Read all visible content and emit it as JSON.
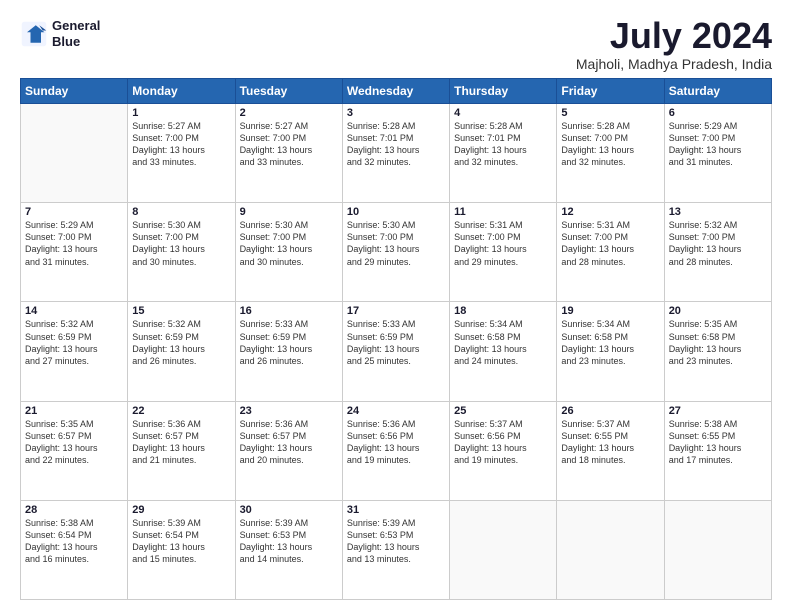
{
  "logo": {
    "line1": "General",
    "line2": "Blue"
  },
  "title": "July 2024",
  "location": "Majholi, Madhya Pradesh, India",
  "headers": [
    "Sunday",
    "Monday",
    "Tuesday",
    "Wednesday",
    "Thursday",
    "Friday",
    "Saturday"
  ],
  "weeks": [
    [
      {
        "day": "",
        "info": ""
      },
      {
        "day": "1",
        "info": "Sunrise: 5:27 AM\nSunset: 7:00 PM\nDaylight: 13 hours\nand 33 minutes."
      },
      {
        "day": "2",
        "info": "Sunrise: 5:27 AM\nSunset: 7:00 PM\nDaylight: 13 hours\nand 33 minutes."
      },
      {
        "day": "3",
        "info": "Sunrise: 5:28 AM\nSunset: 7:01 PM\nDaylight: 13 hours\nand 32 minutes."
      },
      {
        "day": "4",
        "info": "Sunrise: 5:28 AM\nSunset: 7:01 PM\nDaylight: 13 hours\nand 32 minutes."
      },
      {
        "day": "5",
        "info": "Sunrise: 5:28 AM\nSunset: 7:00 PM\nDaylight: 13 hours\nand 32 minutes."
      },
      {
        "day": "6",
        "info": "Sunrise: 5:29 AM\nSunset: 7:00 PM\nDaylight: 13 hours\nand 31 minutes."
      }
    ],
    [
      {
        "day": "7",
        "info": "Sunrise: 5:29 AM\nSunset: 7:00 PM\nDaylight: 13 hours\nand 31 minutes."
      },
      {
        "day": "8",
        "info": "Sunrise: 5:30 AM\nSunset: 7:00 PM\nDaylight: 13 hours\nand 30 minutes."
      },
      {
        "day": "9",
        "info": "Sunrise: 5:30 AM\nSunset: 7:00 PM\nDaylight: 13 hours\nand 30 minutes."
      },
      {
        "day": "10",
        "info": "Sunrise: 5:30 AM\nSunset: 7:00 PM\nDaylight: 13 hours\nand 29 minutes."
      },
      {
        "day": "11",
        "info": "Sunrise: 5:31 AM\nSunset: 7:00 PM\nDaylight: 13 hours\nand 29 minutes."
      },
      {
        "day": "12",
        "info": "Sunrise: 5:31 AM\nSunset: 7:00 PM\nDaylight: 13 hours\nand 28 minutes."
      },
      {
        "day": "13",
        "info": "Sunrise: 5:32 AM\nSunset: 7:00 PM\nDaylight: 13 hours\nand 28 minutes."
      }
    ],
    [
      {
        "day": "14",
        "info": "Sunrise: 5:32 AM\nSunset: 6:59 PM\nDaylight: 13 hours\nand 27 minutes."
      },
      {
        "day": "15",
        "info": "Sunrise: 5:32 AM\nSunset: 6:59 PM\nDaylight: 13 hours\nand 26 minutes."
      },
      {
        "day": "16",
        "info": "Sunrise: 5:33 AM\nSunset: 6:59 PM\nDaylight: 13 hours\nand 26 minutes."
      },
      {
        "day": "17",
        "info": "Sunrise: 5:33 AM\nSunset: 6:59 PM\nDaylight: 13 hours\nand 25 minutes."
      },
      {
        "day": "18",
        "info": "Sunrise: 5:34 AM\nSunset: 6:58 PM\nDaylight: 13 hours\nand 24 minutes."
      },
      {
        "day": "19",
        "info": "Sunrise: 5:34 AM\nSunset: 6:58 PM\nDaylight: 13 hours\nand 23 minutes."
      },
      {
        "day": "20",
        "info": "Sunrise: 5:35 AM\nSunset: 6:58 PM\nDaylight: 13 hours\nand 23 minutes."
      }
    ],
    [
      {
        "day": "21",
        "info": "Sunrise: 5:35 AM\nSunset: 6:57 PM\nDaylight: 13 hours\nand 22 minutes."
      },
      {
        "day": "22",
        "info": "Sunrise: 5:36 AM\nSunset: 6:57 PM\nDaylight: 13 hours\nand 21 minutes."
      },
      {
        "day": "23",
        "info": "Sunrise: 5:36 AM\nSunset: 6:57 PM\nDaylight: 13 hours\nand 20 minutes."
      },
      {
        "day": "24",
        "info": "Sunrise: 5:36 AM\nSunset: 6:56 PM\nDaylight: 13 hours\nand 19 minutes."
      },
      {
        "day": "25",
        "info": "Sunrise: 5:37 AM\nSunset: 6:56 PM\nDaylight: 13 hours\nand 19 minutes."
      },
      {
        "day": "26",
        "info": "Sunrise: 5:37 AM\nSunset: 6:55 PM\nDaylight: 13 hours\nand 18 minutes."
      },
      {
        "day": "27",
        "info": "Sunrise: 5:38 AM\nSunset: 6:55 PM\nDaylight: 13 hours\nand 17 minutes."
      }
    ],
    [
      {
        "day": "28",
        "info": "Sunrise: 5:38 AM\nSunset: 6:54 PM\nDaylight: 13 hours\nand 16 minutes."
      },
      {
        "day": "29",
        "info": "Sunrise: 5:39 AM\nSunset: 6:54 PM\nDaylight: 13 hours\nand 15 minutes."
      },
      {
        "day": "30",
        "info": "Sunrise: 5:39 AM\nSunset: 6:53 PM\nDaylight: 13 hours\nand 14 minutes."
      },
      {
        "day": "31",
        "info": "Sunrise: 5:39 AM\nSunset: 6:53 PM\nDaylight: 13 hours\nand 13 minutes."
      },
      {
        "day": "",
        "info": ""
      },
      {
        "day": "",
        "info": ""
      },
      {
        "day": "",
        "info": ""
      }
    ]
  ]
}
